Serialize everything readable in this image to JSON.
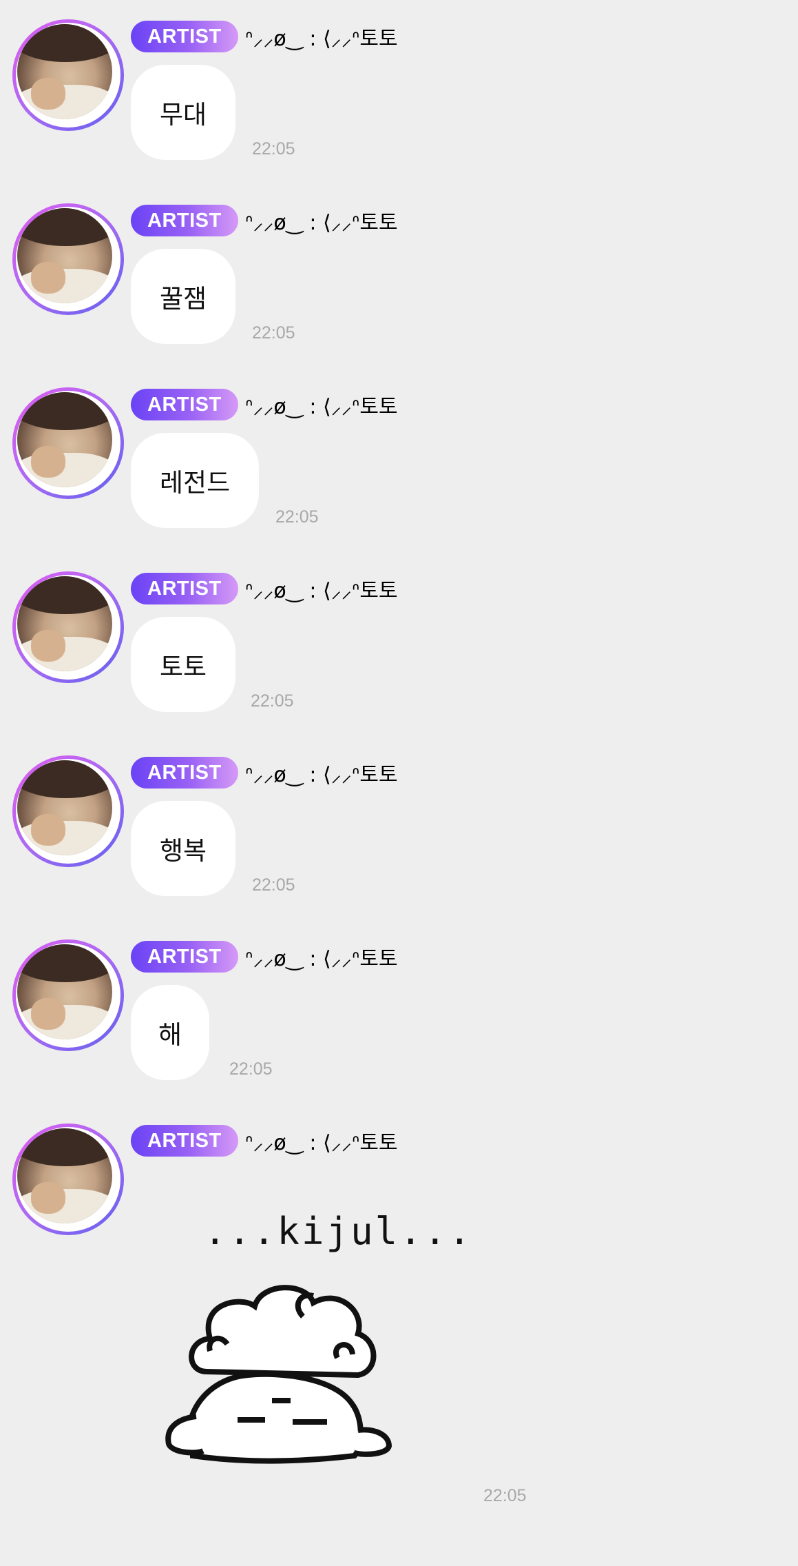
{
  "chat": {
    "badge_label": "ARTIST",
    "nickname": "ᐢ⸝⸝ø‿ : ⟨⸝⸝ᐢ토토",
    "messages": [
      {
        "text": "무대",
        "time": "22:05"
      },
      {
        "text": "꿀잼",
        "time": "22:05"
      },
      {
        "text": "레전드",
        "time": "22:05"
      },
      {
        "text": "토토",
        "time": "22:05"
      },
      {
        "text": "행복",
        "time": "22:05"
      },
      {
        "text": "해",
        "time": "22:05"
      }
    ],
    "sticker_message": {
      "caption": "...kijul...",
      "time": "22:05",
      "sticker_icon": "sleeping-creature-sticker-icon"
    }
  },
  "colors": {
    "background": "#eeeeee",
    "bubble": "#ffffff",
    "badge_gradient_start": "#6a43f5",
    "badge_gradient_end": "#d59af6",
    "avatar_ring_start": "#e15cf0",
    "avatar_ring_end": "#5e60f0",
    "timestamp": "#a8a8a8"
  }
}
